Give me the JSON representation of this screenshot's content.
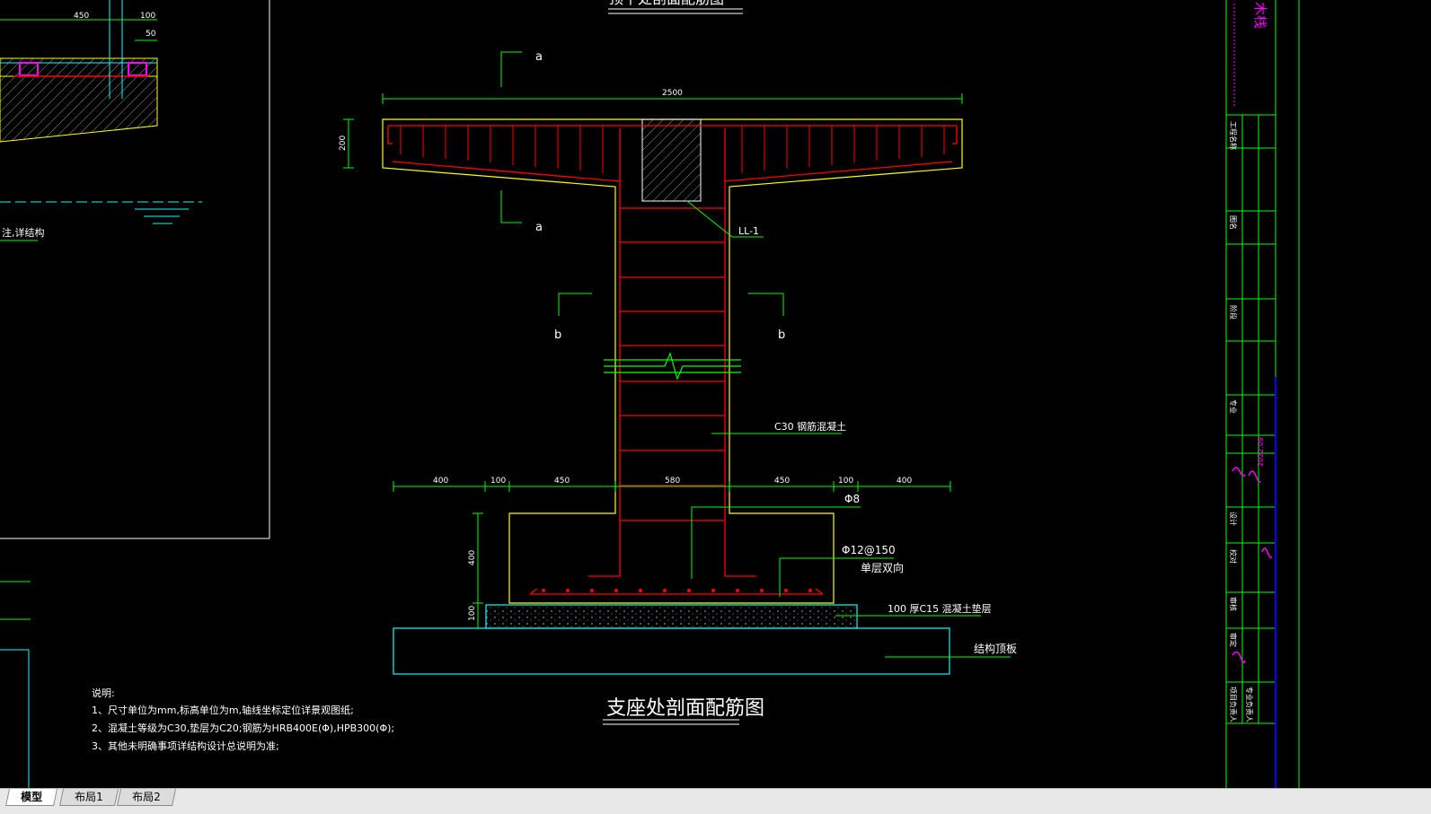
{
  "drawing": {
    "top_title_partial": "顶平处剖面配筋图",
    "main_title": "支座处剖面配筋图",
    "section_marks": {
      "a": "a",
      "b": "b"
    },
    "dims": {
      "top_width": "2500",
      "slab_height": "200",
      "base": [
        "400",
        "100",
        "450",
        "580",
        "450",
        "100",
        "400"
      ],
      "foot_height": "400",
      "pad_height": "100"
    },
    "labels": {
      "beam": "LL-1",
      "concrete": "C30  钢筋混凝土",
      "stirrup": "Φ8",
      "rebar": "Φ12@150",
      "rebar_note": "单层双向",
      "pad": "100  厚C15  混凝土垫层",
      "roof": "结构顶板"
    },
    "left_view": {
      "dims": [
        "450",
        "100",
        "50"
      ],
      "note_fragment": "注,详结构"
    },
    "notes": {
      "title": "说明:",
      "items": [
        "1、尺寸单位为mm,标高单位为m,轴线坐标定位详景观图纸;",
        "2、混凝土等级为C30,垫层为C20;钢筋为HRB400E(Φ),HPB300(Φ);",
        "3、其他未明确事项详结构设计总说明为准;"
      ]
    }
  },
  "title_block": {
    "company": "木栈",
    "rows": [
      "工程名称",
      "图名",
      "阶段",
      "专业",
      "设计",
      "校对",
      "审核",
      "审定",
      "项目负责人",
      "专业负责人"
    ],
    "date": "2022.09"
  },
  "tabs": [
    "模型",
    "布局1",
    "布局2"
  ],
  "colors": {
    "background": "#000000",
    "outline": "#ffff00",
    "rebar": "#ff0000",
    "leader": "#00ff00",
    "pad": "#00ffff",
    "magenta": "#ff00ff"
  }
}
